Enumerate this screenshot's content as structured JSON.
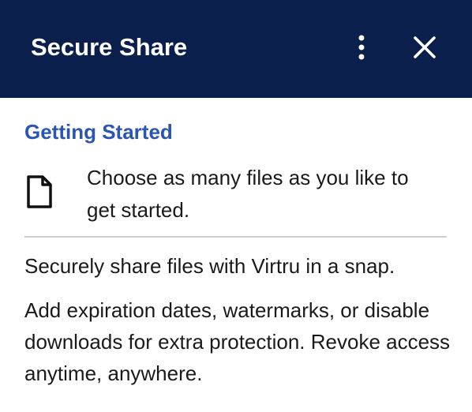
{
  "header": {
    "title": "Secure Share",
    "menu_icon": "kebab-menu-icon",
    "close_icon": "close-icon",
    "background_color": "#0b1f4d"
  },
  "getting_started": {
    "heading": "Getting Started",
    "heading_color": "#2a55b3",
    "file_icon": "file-icon",
    "file_hint": "Choose as many files as you like to get started."
  },
  "info": {
    "intro": "Securely share files with Virtru in a snap.",
    "details": "Add expiration dates, watermarks, or disable downloads for extra protection. Revoke access anytime, anywhere."
  }
}
